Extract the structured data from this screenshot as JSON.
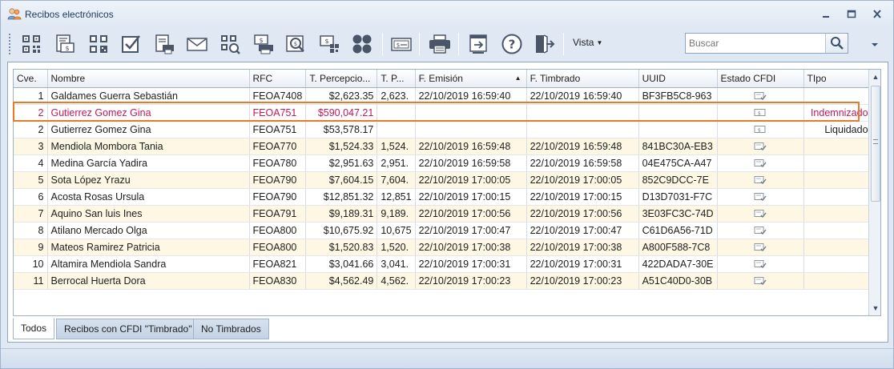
{
  "window": {
    "title": "Recibos electrónicos"
  },
  "toolbar": {
    "buttons": [
      {
        "name": "qr-scan-icon"
      },
      {
        "name": "receipt-money-icon"
      },
      {
        "name": "qr-grid-icon"
      },
      {
        "name": "checkbox-icon"
      },
      {
        "name": "print-document-icon"
      },
      {
        "name": "envelope-icon"
      },
      {
        "name": "qr-search-icon"
      },
      {
        "name": "money-print-icon"
      },
      {
        "name": "money-search-icon"
      },
      {
        "name": "money-qr-icon"
      },
      {
        "name": "four-circles-icon"
      },
      {
        "name": "bill-icon"
      },
      {
        "name": "printer-icon"
      },
      {
        "name": "export-window-icon"
      },
      {
        "name": "help-icon"
      },
      {
        "name": "exit-door-icon"
      }
    ],
    "vista_label": "Vista",
    "search_placeholder": "Buscar"
  },
  "grid": {
    "columns": [
      "Cve.",
      "Nombre",
      "RFC",
      "T. Percepcio...",
      "T. P...",
      "F. Emisión",
      "F. Timbrado",
      "UUID",
      "Estado CFDI",
      "TIpo"
    ],
    "rows": [
      {
        "cve": "1",
        "nombre": "Galdames Guerra Sebastián",
        "rfc": "FEOA7408",
        "tperc": "$2,623.35",
        "tp": "2,623.",
        "femision": "22/10/2019 16:59:40",
        "ftimbrado": "22/10/2019 16:59:40",
        "uuid": "BF3FB5C8-963",
        "estado": "check",
        "tipo": ""
      },
      {
        "cve": "2",
        "nombre": "Gutierrez Gomez Gina",
        "rfc": "FEOA751",
        "tperc": "$590,047.21",
        "tp": "",
        "femision": "",
        "ftimbrado": "",
        "uuid": "",
        "estado": "doc",
        "tipo": "Indemnizado"
      },
      {
        "cve": "2",
        "nombre": "Gutierrez Gomez Gina",
        "rfc": "FEOA751",
        "tperc": "$53,578.17",
        "tp": "",
        "femision": "",
        "ftimbrado": "",
        "uuid": "",
        "estado": "doc",
        "tipo": "Liquidado"
      },
      {
        "cve": "3",
        "nombre": "Mendiola Mombora Tania",
        "rfc": "FEOA770",
        "tperc": "$1,524.33",
        "tp": "1,524.",
        "femision": "22/10/2019 16:59:48",
        "ftimbrado": "22/10/2019 16:59:48",
        "uuid": "841BC30A-EB3",
        "estado": "check",
        "tipo": ""
      },
      {
        "cve": "4",
        "nombre": "Medina García Yadira",
        "rfc": "FEOA780",
        "tperc": "$2,951.63",
        "tp": "2,951.",
        "femision": "22/10/2019 16:59:58",
        "ftimbrado": "22/10/2019 16:59:58",
        "uuid": "04E475CA-A47",
        "estado": "check",
        "tipo": ""
      },
      {
        "cve": "5",
        "nombre": "Sota López Yrazu",
        "rfc": "FEOA790",
        "tperc": "$7,604.15",
        "tp": "7,604.",
        "femision": "22/10/2019 17:00:05",
        "ftimbrado": "22/10/2019 17:00:05",
        "uuid": "852C9DCC-7E",
        "estado": "check",
        "tipo": ""
      },
      {
        "cve": "6",
        "nombre": "Acosta Rosas Ursula",
        "rfc": "FEOA790",
        "tperc": "$12,851.32",
        "tp": "12,851",
        "femision": "22/10/2019 17:00:15",
        "ftimbrado": "22/10/2019 17:00:15",
        "uuid": "D13D7031-F7C",
        "estado": "check",
        "tipo": ""
      },
      {
        "cve": "7",
        "nombre": "Aquino San luis Ines",
        "rfc": "FEOA791",
        "tperc": "$9,189.31",
        "tp": "9,189.",
        "femision": "22/10/2019 17:00:56",
        "ftimbrado": "22/10/2019 17:00:56",
        "uuid": "3E03FC3C-74D",
        "estado": "check",
        "tipo": ""
      },
      {
        "cve": "8",
        "nombre": "Atilano Mercado Olga",
        "rfc": "FEOA800",
        "tperc": "$10,675.92",
        "tp": "10,675",
        "femision": "22/10/2019 17:00:47",
        "ftimbrado": "22/10/2019 17:00:47",
        "uuid": "C61D6A56-71D",
        "estado": "check",
        "tipo": ""
      },
      {
        "cve": "9",
        "nombre": "Mateos Ramirez Patricia",
        "rfc": "FEOA800",
        "tperc": "$1,520.83",
        "tp": "1,520.",
        "femision": "22/10/2019 17:00:38",
        "ftimbrado": "22/10/2019 17:00:38",
        "uuid": "A800F588-7C8",
        "estado": "check",
        "tipo": ""
      },
      {
        "cve": "10",
        "nombre": "Altamira Mendiola Sandra",
        "rfc": "FEOA821",
        "tperc": "$3,041.66",
        "tp": "3,041.",
        "femision": "22/10/2019 17:00:31",
        "ftimbrado": "22/10/2019 17:00:31",
        "uuid": "422DADA7-30E",
        "estado": "check",
        "tipo": ""
      },
      {
        "cve": "11",
        "nombre": "Berrocal Huerta Dora",
        "rfc": "FEOA830",
        "tperc": "$4,562.49",
        "tp": "4,562.",
        "femision": "22/10/2019 17:00:23",
        "ftimbrado": "22/10/2019 17:00:23",
        "uuid": "A51C40D0-30B",
        "estado": "check",
        "tipo": ""
      }
    ]
  },
  "tabs": [
    {
      "label": "Todos",
      "active": true
    },
    {
      "label": "Recibos con CFDI \"Timbrado\"",
      "active": false
    },
    {
      "label": "No Timbrados",
      "active": false
    }
  ],
  "colors": {
    "selected_text": "#c1185b",
    "selection_border": "#e8782a",
    "alt_row": "#fdf7e4"
  }
}
